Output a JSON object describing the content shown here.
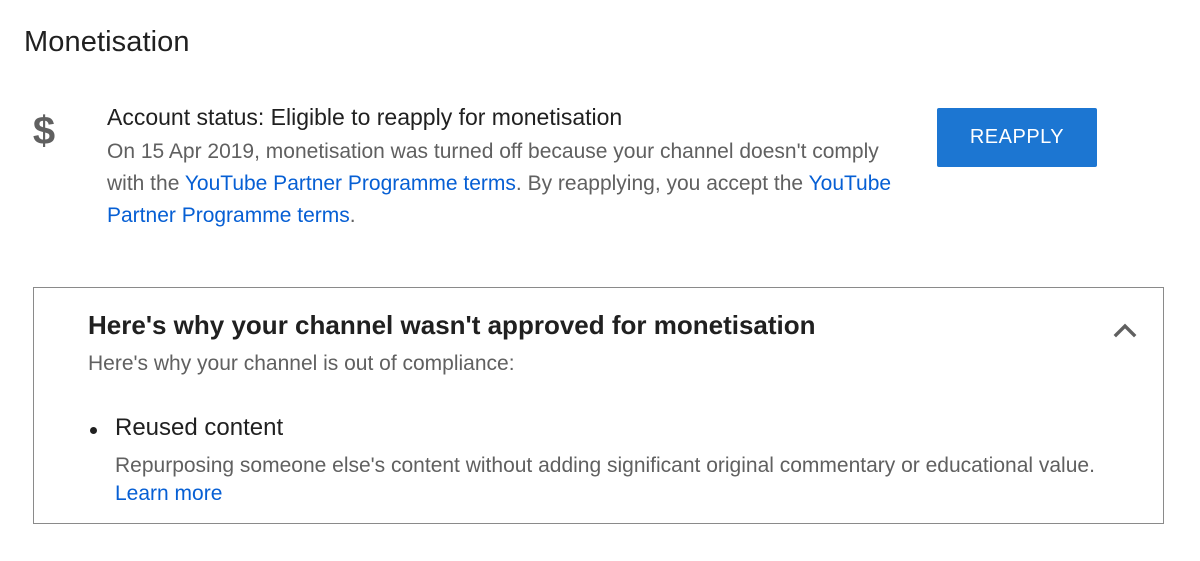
{
  "page": {
    "title": "Monetisation"
  },
  "status": {
    "heading": "Account status: Eligible to reapply for monetisation",
    "desc_part1": "On 15 Apr 2019, monetisation was turned off because your channel doesn't comply with the ",
    "link1": "YouTube Partner Programme terms",
    "desc_part2": ". By reapplying, you accept the ",
    "link2": "YouTube Partner Programme terms",
    "desc_part3": ".",
    "icon": "dollar-icon",
    "reapply_label": "REAPPLY"
  },
  "reasons_panel": {
    "title": "Here's why your channel wasn't approved for monetisation",
    "subtitle": "Here's why your channel is out of compliance:",
    "collapse_icon": "chevron-up-icon",
    "items": [
      {
        "title": "Reused content",
        "desc": "Repurposing someone else's content without adding significant original commentary or educational value.",
        "link": "Learn more"
      }
    ]
  },
  "colors": {
    "accent": "#1c76d2",
    "link": "#065fd4",
    "text_primary": "#202020",
    "text_secondary": "#606060",
    "panel_border": "#8a8a8a"
  }
}
